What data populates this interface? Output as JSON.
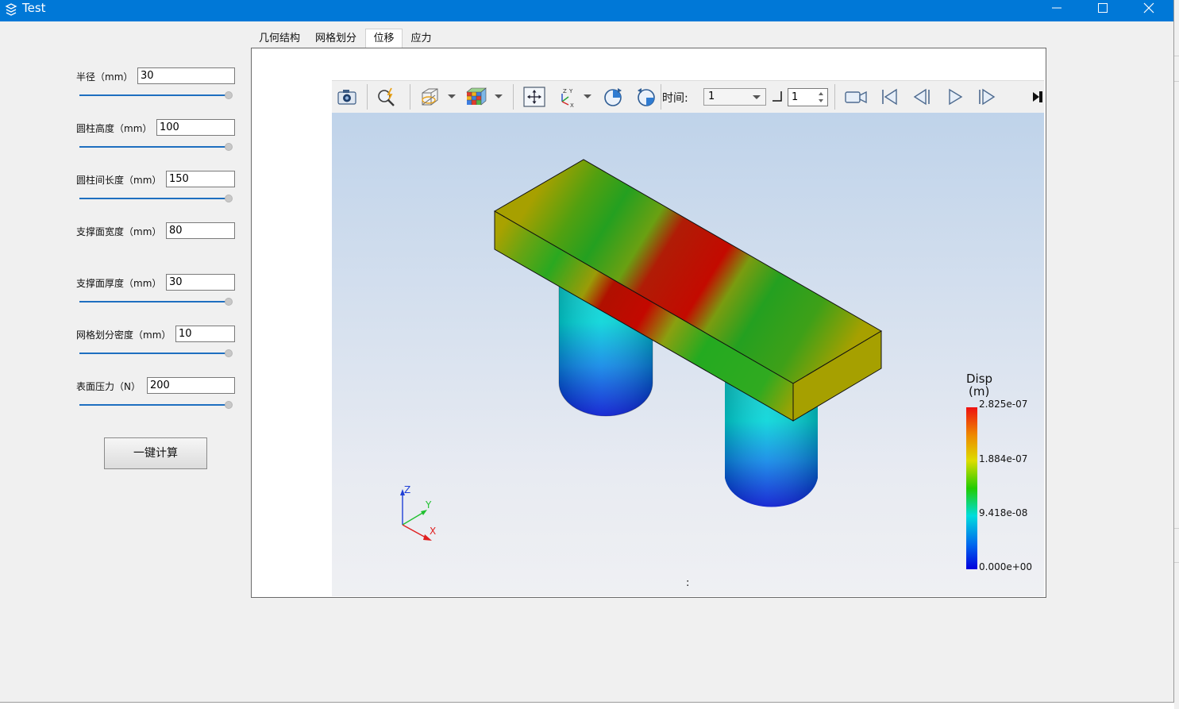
{
  "window": {
    "title": "Test"
  },
  "params": [
    {
      "label": "半径（mm）",
      "value": "30"
    },
    {
      "label": "圆柱高度（mm）",
      "value": "100"
    },
    {
      "label": "圆柱间长度（mm）",
      "value": "150"
    },
    {
      "label": "支撑面宽度（mm）",
      "value": "80"
    },
    {
      "label": "支撑面厚度（mm）",
      "value": "30"
    },
    {
      "label": "网格划分密度（mm）",
      "value": "10"
    },
    {
      "label": "表面压力（N）",
      "value": "200"
    }
  ],
  "calc_button": "一键计算",
  "tabs": [
    "几何结构",
    "网格划分",
    "位移",
    "应力"
  ],
  "active_tab": "位移",
  "toolbar": {
    "time_label": "时间:",
    "time_value": "1",
    "step_value": "1",
    "icons": [
      "camera-icon",
      "query-icon",
      "view-mode-icon",
      "mesh-color-icon",
      "fit-view-icon",
      "axes-view-icon",
      "rotate-cw-icon",
      "rotate-ccw-icon",
      "record-video-icon",
      "first-frame-icon",
      "prev-frame-icon",
      "play-icon",
      "next-frame-icon",
      "toolbar-expand-icon"
    ]
  },
  "legend": {
    "title_line1": "Disp",
    "title_line2": "(m)",
    "ticks": [
      "2.825e-07",
      "1.884e-07",
      "9.418e-08",
      "0.000e+00"
    ]
  },
  "axes": {
    "x": "X",
    "y": "Y",
    "z": "Z"
  },
  "status_text": ":"
}
